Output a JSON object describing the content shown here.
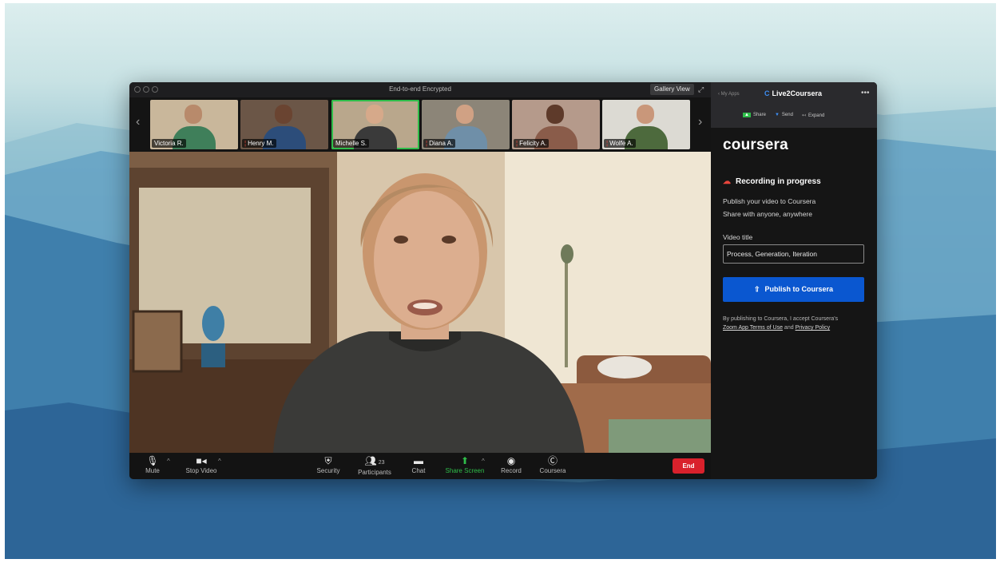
{
  "window": {
    "title": "End-to-end Encrypted",
    "gallery_view_label": "Gallery View"
  },
  "participants_strip": [
    {
      "name": "Victoria R.",
      "muted": false,
      "bg": "#c9b79b",
      "skin": "#b88a6b",
      "shirt": "#3f7f5a"
    },
    {
      "name": "Henry M.",
      "muted": true,
      "bg": "#6b5647",
      "skin": "#6a4431",
      "shirt": "#2c4d7a"
    },
    {
      "name": "Michelle S.",
      "muted": false,
      "active": true,
      "bg": "#b9a78c",
      "skin": "#d6a98a",
      "shirt": "#3a3a3a"
    },
    {
      "name": "Diana A.",
      "muted": true,
      "bg": "#8c8578",
      "skin": "#d0a184",
      "shirt": "#6f8fa8"
    },
    {
      "name": "Felicity A.",
      "muted": true,
      "bg": "#b59a8b",
      "skin": "#5e3a2a",
      "shirt": "#8a5c4a"
    },
    {
      "name": "Wolfe A.",
      "muted": true,
      "bg": "#dcdad3",
      "skin": "#c9977a",
      "shirt": "#4d6a3d"
    }
  ],
  "toolbar": {
    "mute": "Mute",
    "stop_video": "Stop Video",
    "security": "Security",
    "participants": "Participants",
    "participants_count": "23",
    "chat": "Chat",
    "share_screen": "Share Screen",
    "record": "Record",
    "coursera": "Coursera",
    "end": "End"
  },
  "panel": {
    "my_apps": "My Apps",
    "app_name": "Live2Coursera",
    "app_logo": "C",
    "share": "Share",
    "send": "Send",
    "expand": "Expand",
    "brand": "coursera",
    "recording_status": "Recording in progress",
    "desc_line1": "Publish your video to Coursera",
    "desc_line2": "Share with anyone, anywhere",
    "video_title_label": "Video title",
    "video_title_value": "Process, Generation, Iteration",
    "publish_button": "Publish to Coursera",
    "terms_prefix": "By publishing to Coursera, I accept Coursera's",
    "terms_link1": "Zoom App Terms of Use",
    "terms_and": "and",
    "terms_link2": "Privacy Policy"
  },
  "colors": {
    "accent_green": "#2fbd4a",
    "end_red": "#d9212c",
    "publish_blue": "#0a57d0"
  }
}
